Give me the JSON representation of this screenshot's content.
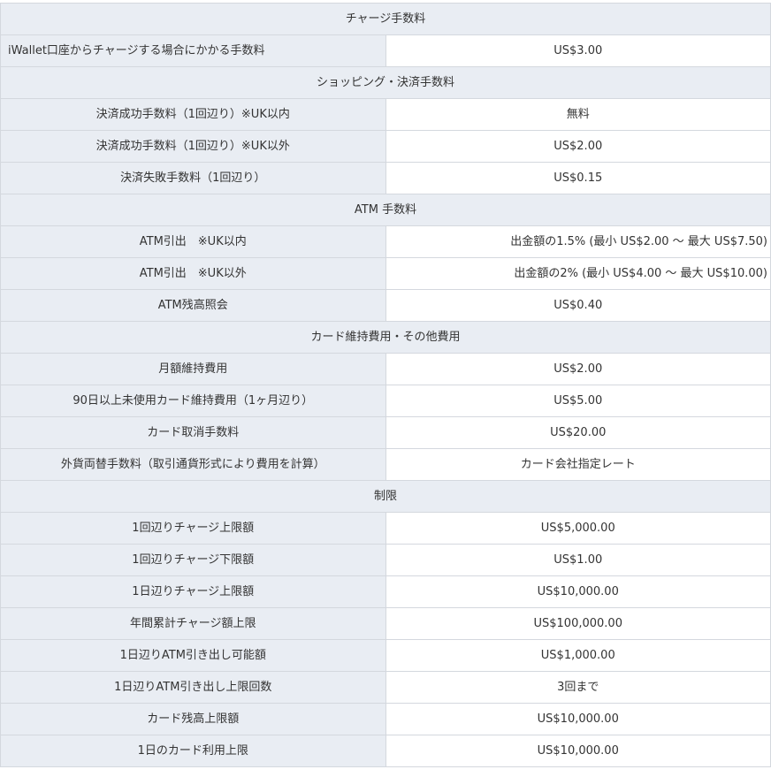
{
  "sections": [
    {
      "title": "チャージ手数料",
      "rows": [
        {
          "label": "iWallet口座からチャージする場合にかかる手数料",
          "value": "US$3.00"
        }
      ]
    },
    {
      "title": "ショッピング・決済手数料",
      "rows": [
        {
          "label": "決済成功手数料（1回辺り）※UK以内",
          "value": "無料"
        },
        {
          "label": "決済成功手数料（1回辺り）※UK以外",
          "value": "US$2.00"
        },
        {
          "label": "決済失敗手数料（1回辺り）",
          "value": "US$0.15"
        }
      ]
    },
    {
      "title": "ATM 手数料",
      "rows": [
        {
          "label": "ATM引出　※UK以内",
          "value": "出金額の1.5% (最小 US$2.00 ～ 最大 US$7.50)"
        },
        {
          "label": "ATM引出　※UK以外",
          "value": "出金額の2% (最小 US$4.00 ～ 最大 US$10.00)"
        },
        {
          "label": "ATM残高照会",
          "value": "US$0.40"
        }
      ]
    },
    {
      "title": "カード維持費用・その他費用",
      "rows": [
        {
          "label": "月額維持費用",
          "value": "US$2.00"
        },
        {
          "label": "90日以上未使用カード維持費用（1ヶ月辺り）",
          "value": "US$5.00"
        },
        {
          "label": "カード取消手数料",
          "value": "US$20.00"
        },
        {
          "label": "外貨両替手数料（取引通貨形式により費用を計算）",
          "value": "カード会社指定レート"
        }
      ]
    },
    {
      "title": "制限",
      "rows": [
        {
          "label": "1回辺りチャージ上限額",
          "value": "US$5,000.00"
        },
        {
          "label": "1回辺りチャージ下限額",
          "value": "US$1.00"
        },
        {
          "label": "1日辺りチャージ上限額",
          "value": "US$10,000.00"
        },
        {
          "label": "年間累計チャージ額上限",
          "value": "US$100,000.00"
        },
        {
          "label": "1日辺りATM引き出し可能額",
          "value": "US$1,000.00"
        },
        {
          "label": "1日辺りATM引き出し上限回数",
          "value": "3回まで"
        },
        {
          "label": "カード残高上限額",
          "value": "US$10,000.00"
        },
        {
          "label": "1日のカード利用上限",
          "value": "US$10,000.00"
        }
      ]
    }
  ]
}
